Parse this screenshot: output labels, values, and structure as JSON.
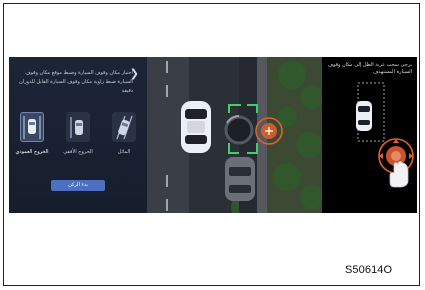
{
  "left_panel": {
    "back_label": "❯",
    "instruction": "اختيار مكان وقوف السيارة وضبط موقع مكان وقوف السيارة ضبط زاوية مكان وقوف السيارة القابل للدوران دقيقة",
    "modes": [
      {
        "label": "الخروج العمودي",
        "selected": true
      },
      {
        "label": "الخروج الأفقي",
        "selected": false
      },
      {
        "label": "المائل",
        "selected": false
      }
    ],
    "start_button": "بدء الركن"
  },
  "right_panel": {
    "instruction": "يرجى سحب عربة الظل إلى مكان وقوف السيارة المستهدف"
  },
  "caption": "S50614O",
  "colors": {
    "accent_orange": "#e0622b",
    "guide_green": "#3ecf6a",
    "button_blue": "#4c6fc0"
  }
}
